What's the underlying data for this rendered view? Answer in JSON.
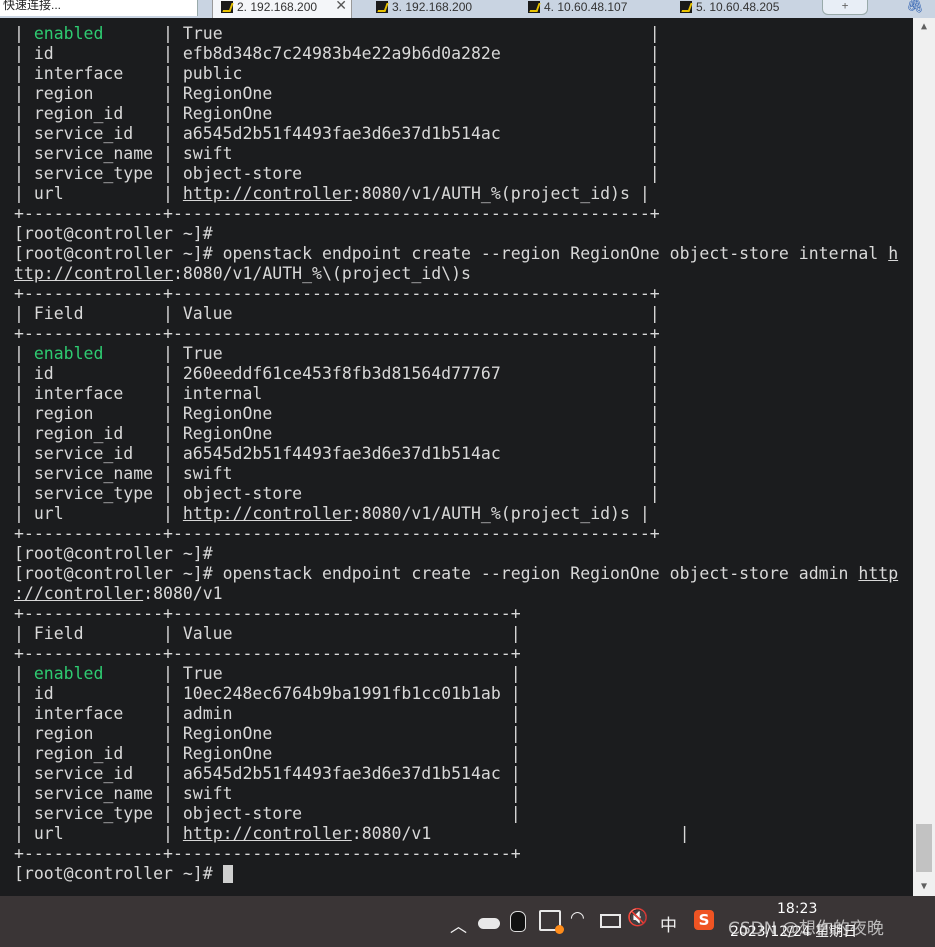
{
  "tabs": {
    "search_text": "快速连接...",
    "items": [
      {
        "label": "2. 192.168.200"
      },
      {
        "label": "3. 192.168.200"
      },
      {
        "label": "4. 10.60.48.107"
      },
      {
        "label": "5. 10.60.48.205"
      }
    ],
    "close_glyph": "✕",
    "new_tab_glyph": "+"
  },
  "terminal": {
    "lines": [
      {
        "segments": [
          {
            "text": "| "
          },
          {
            "text": "enabled",
            "style": "green"
          },
          {
            "text": "      | True                                           |"
          }
        ]
      },
      {
        "segments": [
          {
            "text": "| id           | efb8d348c7c24983b4e22a9b6d0a282e               |"
          }
        ]
      },
      {
        "segments": [
          {
            "text": "| interface    | public                                         |"
          }
        ]
      },
      {
        "segments": [
          {
            "text": "| region       | RegionOne                                      |"
          }
        ]
      },
      {
        "segments": [
          {
            "text": "| region_id    | RegionOne                                      |"
          }
        ]
      },
      {
        "segments": [
          {
            "text": "| service_id   | a6545d2b51f4493fae3d6e37d1b514ac               |"
          }
        ]
      },
      {
        "segments": [
          {
            "text": "| service_name | swift                                          |"
          }
        ]
      },
      {
        "segments": [
          {
            "text": "| service_type | object-store                                   |"
          }
        ]
      },
      {
        "segments": [
          {
            "text": "| url          | "
          },
          {
            "text": "http://controller",
            "style": "link"
          },
          {
            "text": ":8080/v1/AUTH_%(project_id)s |"
          }
        ]
      },
      {
        "segments": [
          {
            "text": "+--------------+------------------------------------------------+"
          }
        ]
      },
      {
        "segments": [
          {
            "text": "[root@controller ~]#"
          }
        ]
      },
      {
        "segments": [
          {
            "text": "[root@controller ~]# openstack endpoint create --region RegionOne object-store internal "
          },
          {
            "text": "h",
            "style": "link"
          }
        ]
      },
      {
        "segments": [
          {
            "text": "ttp://controller",
            "style": "link"
          },
          {
            "text": ":8080/v1/AUTH_%\\(project_id\\)s"
          }
        ]
      },
      {
        "segments": [
          {
            "text": "+--------------+------------------------------------------------+"
          }
        ]
      },
      {
        "segments": [
          {
            "text": "| Field        | Value                                          |"
          }
        ]
      },
      {
        "segments": [
          {
            "text": "+--------------+------------------------------------------------+"
          }
        ]
      },
      {
        "segments": [
          {
            "text": "| "
          },
          {
            "text": "enabled",
            "style": "green"
          },
          {
            "text": "      | True                                           |"
          }
        ]
      },
      {
        "segments": [
          {
            "text": "| id           | 260eeddf61ce453f8fb3d81564d77767               |"
          }
        ]
      },
      {
        "segments": [
          {
            "text": "| interface    | internal                                       |"
          }
        ]
      },
      {
        "segments": [
          {
            "text": "| region       | RegionOne                                      |"
          }
        ]
      },
      {
        "segments": [
          {
            "text": "| region_id    | RegionOne                                      |"
          }
        ]
      },
      {
        "segments": [
          {
            "text": "| service_id   | a6545d2b51f4493fae3d6e37d1b514ac               |"
          }
        ]
      },
      {
        "segments": [
          {
            "text": "| service_name | swift                                          |"
          }
        ]
      },
      {
        "segments": [
          {
            "text": "| service_type | object-store                                   |"
          }
        ]
      },
      {
        "segments": [
          {
            "text": "| url          | "
          },
          {
            "text": "http://controller",
            "style": "link"
          },
          {
            "text": ":8080/v1/AUTH_%(project_id)s |"
          }
        ]
      },
      {
        "segments": [
          {
            "text": "+--------------+------------------------------------------------+"
          }
        ]
      },
      {
        "segments": [
          {
            "text": "[root@controller ~]#"
          }
        ]
      },
      {
        "segments": [
          {
            "text": "[root@controller ~]# openstack endpoint create --region RegionOne object-store admin "
          },
          {
            "text": "http",
            "style": "link"
          }
        ]
      },
      {
        "segments": [
          {
            "text": "://controller",
            "style": "link"
          },
          {
            "text": ":8080/v1"
          }
        ]
      },
      {
        "segments": [
          {
            "text": "+--------------+----------------------------------+"
          }
        ]
      },
      {
        "segments": [
          {
            "text": "| Field        | Value                            |"
          }
        ]
      },
      {
        "segments": [
          {
            "text": "+--------------+----------------------------------+"
          }
        ]
      },
      {
        "segments": [
          {
            "text": "| "
          },
          {
            "text": "enabled",
            "style": "green"
          },
          {
            "text": "      | True                             |"
          }
        ]
      },
      {
        "segments": [
          {
            "text": "| id           | 10ec248ec6764b9ba1991fb1cc01b1ab |"
          }
        ]
      },
      {
        "segments": [
          {
            "text": "| interface    | admin                            |"
          }
        ]
      },
      {
        "segments": [
          {
            "text": "| region       | RegionOne                        |"
          }
        ]
      },
      {
        "segments": [
          {
            "text": "| region_id    | RegionOne                        |"
          }
        ]
      },
      {
        "segments": [
          {
            "text": "| service_id   | a6545d2b51f4493fae3d6e37d1b514ac |"
          }
        ]
      },
      {
        "segments": [
          {
            "text": "| service_name | swift                            |"
          }
        ]
      },
      {
        "segments": [
          {
            "text": "| service_type | object-store                     |"
          }
        ]
      },
      {
        "segments": [
          {
            "text": "| url          | "
          },
          {
            "text": "http://controller",
            "style": "link"
          },
          {
            "text": ":8080/v1                         |"
          }
        ]
      },
      {
        "segments": [
          {
            "text": "+--------------+----------------------------------+"
          }
        ]
      }
    ],
    "prompt": "[root@controller ~]# "
  },
  "scrollbar": {
    "up_glyph": "▲",
    "down_glyph": "▼"
  },
  "taskbar": {
    "chevron_glyph": "︿",
    "wifi_glyph": "◠",
    "volume_glyph": "🔇",
    "ime_label": "中",
    "sogou_label": "S",
    "time": "18:23",
    "date": "2023/12/24 星期日",
    "watermark": "CSDN @想你的夜晚"
  },
  "colors": {
    "terminal_bg": "#1b1c1e",
    "terminal_fg": "#d8d8d8",
    "enabled_green": "#2ecc71",
    "taskbar_bg": "#3a3536"
  }
}
